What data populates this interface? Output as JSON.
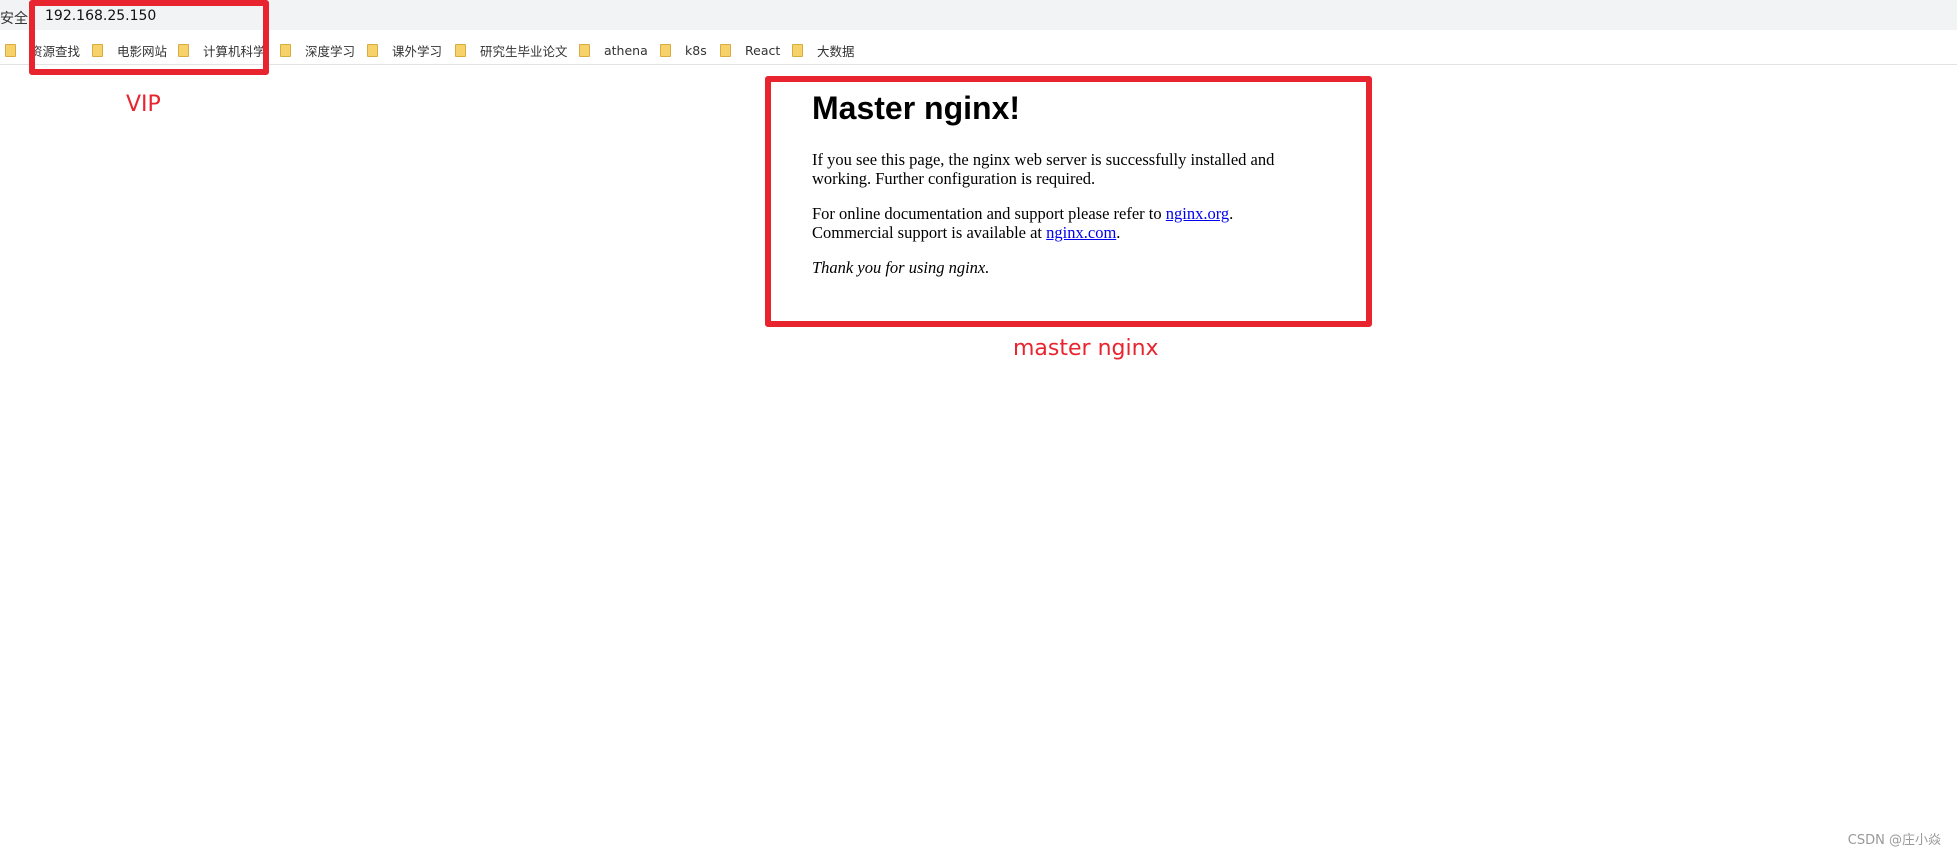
{
  "browser": {
    "security_label": "安全",
    "url": "192.168.25.150",
    "bookmarks": [
      {
        "label": "资源查找"
      },
      {
        "label": "电影网站"
      },
      {
        "label": "计算机科学"
      },
      {
        "label": "深度学习"
      },
      {
        "label": "课外学习"
      },
      {
        "label": "研究生毕业论文"
      },
      {
        "label": "athena"
      },
      {
        "label": "k8s"
      },
      {
        "label": "React"
      },
      {
        "label": "大数据"
      }
    ]
  },
  "annotations": {
    "vip_label": "VIP",
    "master_label": "master nginx",
    "color": "#e8242f"
  },
  "nginx": {
    "title": "Master nginx!",
    "para1": "If you see this page, the nginx web server is successfully installed and working. Further configuration is required.",
    "para2_prefix": "For online documentation and support please refer to ",
    "link_org": "nginx.org",
    "para2_middle": ".",
    "para2_line2": "Commercial support is available at ",
    "link_com": "nginx.com",
    "para2_suffix": ".",
    "thanks": "Thank you for using nginx."
  },
  "watermark": "CSDN @庄小焱"
}
